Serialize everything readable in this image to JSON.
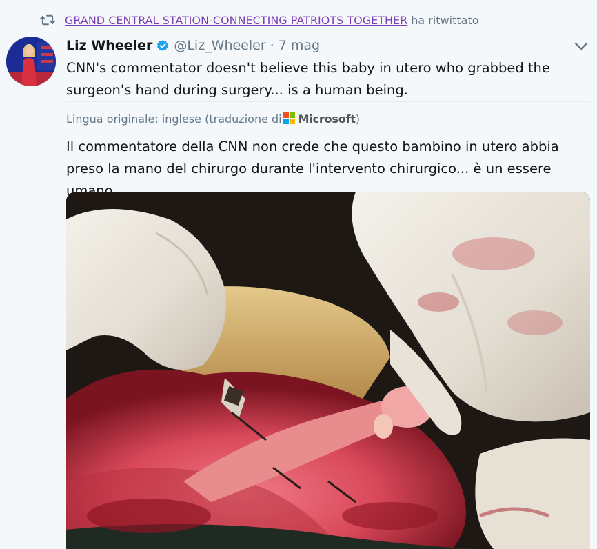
{
  "retweet": {
    "icon": "retweet-icon",
    "retweeter_name": "GRAND CENTRAL STATION-CONNECTING PATRIOTS TOGETHER",
    "suffix": "ha ritwittato"
  },
  "author": {
    "display_name": "Liz Wheeler",
    "verified": true,
    "handle": "@Liz_Wheeler",
    "separator": "·",
    "timestamp": "7 mag"
  },
  "tweet": {
    "original_text": "CNN's commentator doesn't believe this baby in utero who grabbed the surgeon's hand during surgery... is a human being.",
    "translation_label": "Lingua originale: inglese (traduzione di",
    "translation_provider": "Microsoft",
    "translation_close": ")",
    "translated_text": "Il commentatore della CNN non crede che questo bambino in utero abbia preso la mano del chirurgo durante l'intervento chirurgico... è un essere umano."
  },
  "colors": {
    "link": "#7d3fb5",
    "muted": "#657786",
    "verified": "#1da1f2",
    "background": "#f5f8fa"
  }
}
